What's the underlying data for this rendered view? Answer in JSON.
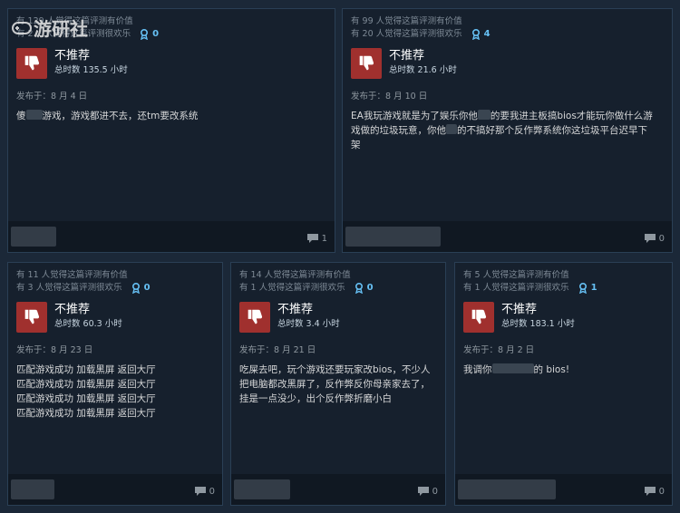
{
  "watermark": {
    "text": "游研社"
  },
  "reviews": [
    {
      "helpful_count_text": "有 129 人觉得这篇评测有价值",
      "funny_count_text": "有 2… 人觉得这篇评测很欢乐",
      "awards": "0",
      "verdict": "不推荐",
      "hours": "总时数 135.5 小时",
      "posted": "发布于：8 月 4 日",
      "lines": [
        {
          "before": "傻",
          "after": "游戏，游戏都进不去，还tm要改系统"
        }
      ],
      "comments": "1"
    },
    {
      "helpful_count_text": "有 99 人觉得这篇评测有价值",
      "funny_count_text": "有 20 人觉得这篇评测很欢乐",
      "awards": "4",
      "verdict": "不推荐",
      "hours": "总时数 21.6 小时",
      "posted": "发布于：8 月 10 日",
      "lines": [
        {
          "before": "EA我玩游戏就是为了娱乐你他",
          "after": "的要我进主板搞bios才能玩你做什么游"
        },
        {
          "before": "",
          "after": "戏做的垃圾玩意，你他"
        },
        {
          "before": "",
          "after": "的不搞好那个反作弊系统你这垃圾平台迟早下"
        },
        {
          "before": "",
          "after": "架"
        }
      ],
      "comments": "0"
    },
    {
      "helpful_count_text": "有 11 人觉得这篇评测有价值",
      "funny_count_text": "有 3 人觉得这篇评测很欢乐",
      "awards": "0",
      "verdict": "不推荐",
      "hours": "总时数 60.3 小时",
      "posted": "发布于：8 月 23 日",
      "lines": [
        {
          "before": "",
          "after": "匹配游戏成功 加载黑屏 返回大厅"
        },
        {
          "before": "",
          "after": "匹配游戏成功 加载黑屏 返回大厅"
        },
        {
          "before": "",
          "after": "匹配游戏成功 加载黑屏 返回大厅"
        },
        {
          "before": "",
          "after": "匹配游戏成功 加载黑屏 返回大厅"
        }
      ],
      "comments": "0"
    },
    {
      "helpful_count_text": "有 14 人觉得这篇评测有价值",
      "funny_count_text": "有 1 人觉得这篇评测很欢乐",
      "awards": "0",
      "verdict": "不推荐",
      "hours": "总时数 3.4 小时",
      "posted": "发布于：8 月 21 日",
      "lines": [
        {
          "before": "",
          "after": "吃屎去吧，玩个游戏还要玩家改bios，不少人"
        },
        {
          "before": "",
          "after": "把电脑都改黑屏了，反作弊反你母亲家去了，"
        },
        {
          "before": "",
          "after": "挂是一点没少，出个反作弊折磨小白"
        }
      ],
      "comments": "0"
    },
    {
      "helpful_count_text": "有 5 人觉得这篇评测有价值",
      "funny_count_text": "有 1 人觉得这篇评测很欢乐",
      "awards": "1",
      "verdict": "不推荐",
      "hours": "总时数 183.1 小时",
      "posted": "发布于：8 月 2 日",
      "lines": [
        {
          "before": "我调你",
          "after": "的 bios!"
        }
      ],
      "comments": "0"
    }
  ]
}
